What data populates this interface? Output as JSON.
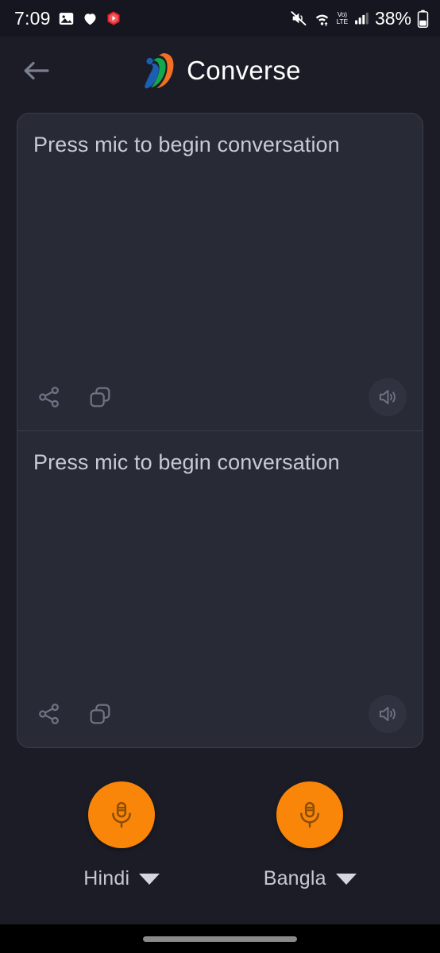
{
  "status_bar": {
    "time": "7:09",
    "battery_percent": "38%",
    "network_label": "Vo)",
    "network_label2": "LTE",
    "icons": [
      "photos-icon",
      "heart-icon",
      "youtube-icon",
      "mute-icon",
      "wifi-icon",
      "volte-icon",
      "signal-icon",
      "battery-icon"
    ]
  },
  "app_bar": {
    "back_icon": "back-arrow-icon",
    "logo_icon": "bhashini-logo-icon",
    "title": "Converse"
  },
  "conversation": {
    "panels": [
      {
        "text": "Press mic to begin conversation",
        "share_icon": "share-icon",
        "copy_icon": "copy-icon",
        "speaker_icon": "speaker-icon"
      },
      {
        "text": "Press mic to begin conversation",
        "share_icon": "share-icon",
        "copy_icon": "copy-icon",
        "speaker_icon": "speaker-icon"
      }
    ]
  },
  "controls": {
    "mic_icon": "microphone-icon",
    "caret_icon": "chevron-down-icon",
    "languages": [
      {
        "label": "Hindi"
      },
      {
        "label": "Bangla"
      }
    ]
  },
  "nav_bar": {
    "handle": "gesture-handle"
  },
  "colors": {
    "page_background": "#1b1c26",
    "status_bar_background": "#15161f",
    "card_background": "#282a36",
    "card_border": "#3b3d4b",
    "accent_orange": "#f98609",
    "text_primary": "#ffffff",
    "text_secondary": "#c8cad6",
    "nav_bar_background": "#000000"
  }
}
